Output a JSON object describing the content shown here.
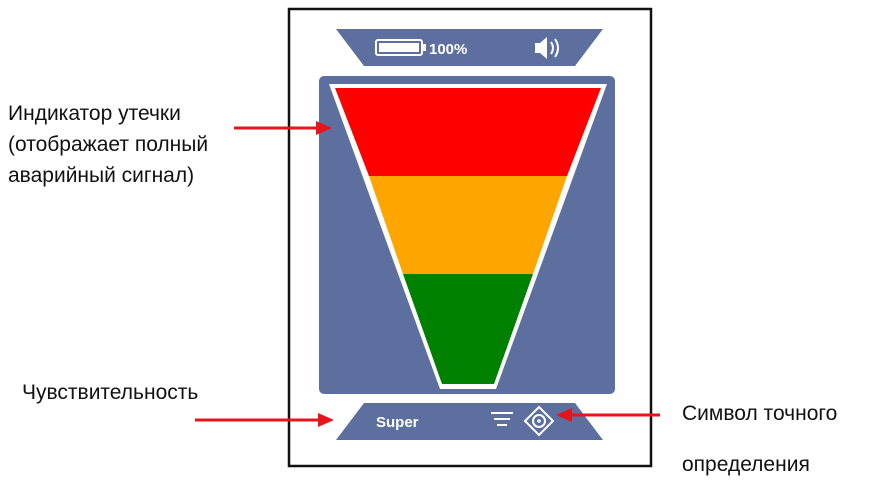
{
  "device": {
    "battery_text": "100%",
    "sensitivity_value": "Super",
    "icons": [
      "battery-icon",
      "speaker-icon",
      "signal-bars-icon",
      "crosshair-icon"
    ]
  },
  "annotations": {
    "leak_indicator": [
      "Индикатор утечки",
      "(отображает полный",
      "аварийный сигнал)"
    ],
    "sensitivity": "Чувствительность",
    "pinpoint_symbol": [
      "Символ точного",
      "определения"
    ]
  },
  "colors": {
    "panel": "#5d6f9f",
    "alarm_red": "#ff0000",
    "alarm_orange": "#ffa500",
    "alarm_green": "#008000",
    "arrow": "#e8141c",
    "frame": "#111111"
  }
}
